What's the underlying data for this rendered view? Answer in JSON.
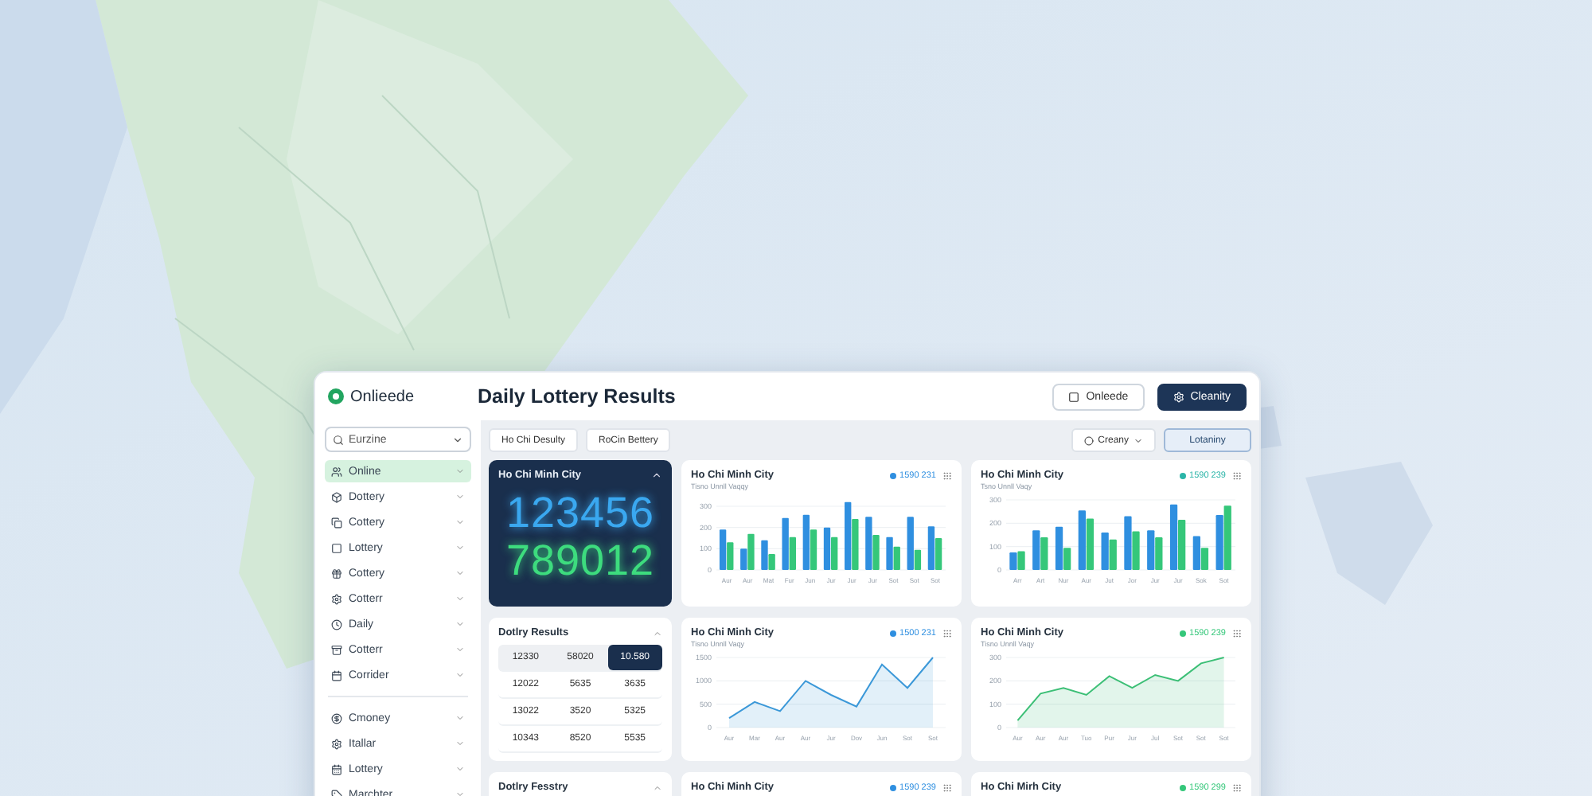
{
  "app": {
    "logo_text": "Onlieede",
    "title": "Daily Lottery Results",
    "header_buttons": [
      {
        "label": "Onleede",
        "kind": "outline"
      },
      {
        "label": "Cleanity",
        "kind": "primary"
      }
    ]
  },
  "sidebar": {
    "search": {
      "value": "Eurzine"
    },
    "groups": [
      {
        "items": [
          {
            "label": "Online",
            "selected": true
          },
          {
            "label": "Dottery",
            "selected": false
          },
          {
            "label": "Cottery",
            "selected": false
          },
          {
            "label": "Lottery",
            "selected": false
          },
          {
            "label": "Cottery",
            "selected": false
          },
          {
            "label": "Cotterr",
            "selected": false
          },
          {
            "label": "Daily",
            "selected": false
          },
          {
            "label": "Cotterr",
            "selected": false
          },
          {
            "label": "Corrider",
            "selected": false
          }
        ]
      },
      {
        "items": [
          {
            "label": "Cmoney",
            "selected": false
          },
          {
            "label": "Itallar",
            "selected": false
          },
          {
            "label": "Lottery",
            "selected": false
          },
          {
            "label": "Marchter",
            "selected": false
          }
        ]
      }
    ]
  },
  "toolbar": {
    "tabs": [
      {
        "label": "Ho Chi Desulty",
        "selected": false
      },
      {
        "label": "RoCin Bettery",
        "selected": false
      }
    ],
    "dropdown": {
      "label": "Creany"
    },
    "button": {
      "label": "Lotaniny"
    }
  },
  "result_card": {
    "title": "Ho Chi Minh City",
    "numbers": [
      {
        "value": "123456",
        "color": "#3aa8f0"
      },
      {
        "value": "789012",
        "color": "#3ddc7e"
      }
    ]
  },
  "results_table": {
    "title": "Dotlry Results",
    "header": [
      {
        "text": "12330",
        "selected": false
      },
      {
        "text": "58020",
        "selected": false
      },
      {
        "text": "10.580",
        "selected": true
      }
    ],
    "rows": [
      [
        "12022",
        "5635",
        "3635"
      ],
      [
        "13022",
        "3520",
        "5325"
      ],
      [
        "10343",
        "8520",
        "5535"
      ]
    ]
  },
  "bottom_card": {
    "title": "Dotlry Fesstry"
  },
  "charts": [
    {
      "title": "Ho Chi Minh City",
      "subtitle": "Tisno Unnll Vaqqy",
      "legend": "1590 231",
      "color": "#2f8fe0",
      "chart_data": {
        "type": "bar",
        "categories": [
          "Aur",
          "Aur",
          "Mat",
          "Fur",
          "Jun",
          "Jur",
          "Jur",
          "Jur",
          "Sot",
          "Sot",
          "Sot"
        ],
        "series": [
          {
            "color": "#2f8fe0",
            "values": [
              190,
              100,
              140,
              245,
              260,
              200,
              320,
              250,
              155,
              250,
              205
            ]
          },
          {
            "color": "#35c77a",
            "values": [
              130,
              170,
              75,
              155,
              190,
              155,
              240,
              165,
              110,
              95,
              150
            ]
          }
        ],
        "ylim": [
          0,
          330
        ],
        "yticks": [
          0,
          100,
          200,
          300
        ],
        "grid": true
      }
    },
    {
      "title": "Ho Chi Minh City",
      "subtitle": "Tsno Unnll Vaqy",
      "legend": "1590 239",
      "color": "#2bb5a8",
      "chart_data": {
        "type": "bar",
        "categories": [
          "Arr",
          "Art",
          "Nur",
          "Aur",
          "Jut",
          "Jor",
          "Jur",
          "Jur",
          "Sok",
          "Sot"
        ],
        "series": [
          {
            "color": "#2f8fe0",
            "values": [
              75,
              170,
              185,
              255,
              160,
              230,
              170,
              280,
              145,
              235
            ]
          },
          {
            "color": "#35c77a",
            "values": [
              80,
              140,
              95,
              220,
              130,
              165,
              140,
              215,
              95,
              275
            ]
          }
        ],
        "ylim": [
          0,
          300
        ],
        "yticks": [
          0,
          100,
          200,
          300
        ],
        "grid": true
      }
    },
    {
      "title": "Ho Chi Minh City",
      "subtitle": "Tisno Unnll Vaqy",
      "legend": "1500 231",
      "color": "#2f8fe0",
      "chart_data": {
        "type": "area",
        "categories": [
          "Aur",
          "Mar",
          "Aur",
          "Aur",
          "Jur",
          "Dov",
          "Jun",
          "Sot",
          "Sot"
        ],
        "series": [
          {
            "color": "#3b98d8",
            "values": [
              200,
              550,
              350,
              1000,
              700,
              450,
              1350,
              850,
              1500
            ]
          }
        ],
        "ylim": [
          0,
          1500
        ],
        "yticks": [
          0,
          500,
          1000,
          1500
        ],
        "grid": true
      }
    },
    {
      "title": "Ho Chi Minh City",
      "subtitle": "Tisno Unnll Vaqy",
      "legend": "1590 239",
      "color": "#35c77a",
      "chart_data": {
        "type": "area",
        "categories": [
          "Aur",
          "Aur",
          "Aur",
          "Tuo",
          "Pur",
          "Jur",
          "Jul",
          "Sot",
          "Sot",
          "Sot"
        ],
        "series": [
          {
            "color": "#3cbf76",
            "values": [
              30,
              145,
              170,
              140,
              220,
              170,
              225,
              200,
              275,
              300
            ]
          }
        ],
        "ylim": [
          0,
          300
        ],
        "yticks": [
          0,
          100,
          200,
          300
        ],
        "grid": true
      }
    },
    {
      "title": "Ho Chi Minh City",
      "legend": "1590 239",
      "color": "#2f8fe0"
    },
    {
      "title": "Ho Chi Mirh City",
      "legend": "1590 299",
      "color": "#35c77a"
    }
  ]
}
